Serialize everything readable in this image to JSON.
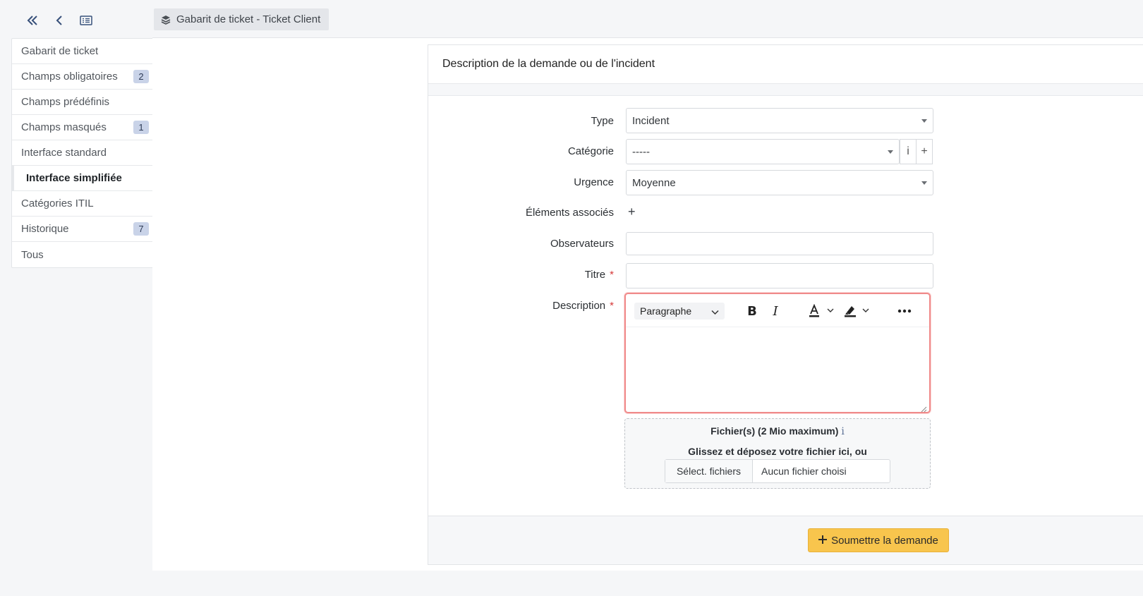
{
  "breadcrumb": {
    "label": "Gabarit de ticket - Ticket Client"
  },
  "sidebar": {
    "items": [
      {
        "label": "Gabarit de ticket",
        "badge": ""
      },
      {
        "label": "Champs obligatoires",
        "badge": "2"
      },
      {
        "label": "Champs prédéfinis",
        "badge": ""
      },
      {
        "label": "Champs masqués",
        "badge": "1"
      },
      {
        "label": "Interface standard",
        "badge": ""
      },
      {
        "label": "Interface simplifiée",
        "badge": "",
        "active": true
      },
      {
        "label": "Catégories ITIL",
        "badge": ""
      },
      {
        "label": "Historique",
        "badge": "7"
      },
      {
        "label": "Tous",
        "badge": ""
      }
    ]
  },
  "card": {
    "title": "Description de la demande ou de l'incident"
  },
  "form": {
    "type_label": "Type",
    "type_value": "Incident",
    "category_label": "Catégorie",
    "category_value": "-----",
    "category_info": "i",
    "category_add": "+",
    "urgency_label": "Urgence",
    "urgency_value": "Moyenne",
    "items_label": "Éléments associés",
    "items_add": "+",
    "observers_label": "Observateurs",
    "observers_value": "",
    "title_label": "Titre",
    "title_value": "",
    "required_mark": "*",
    "description_label": "Description"
  },
  "editor": {
    "block_format": "Paragraphe",
    "content": ""
  },
  "upload": {
    "title": "Fichier(s) (2 Mio maximum)",
    "info": "i",
    "hint": "Glissez et déposez votre fichier ici, ou",
    "button": "Sélect. fichiers",
    "no_file": "Aucun fichier choisi"
  },
  "footer": {
    "submit_label": "Soumettre la demande"
  },
  "colors": {
    "accent": "#f8c54d",
    "required": "#d63939",
    "error_border": "#f08a8a",
    "badge_bg": "#c9d3e8"
  }
}
